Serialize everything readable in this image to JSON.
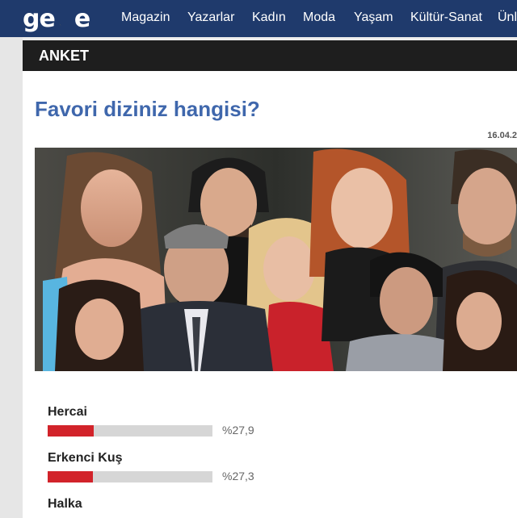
{
  "site": {
    "logo_text": "gece",
    "nav": [
      "Magazin",
      "Yazarlar",
      "Kadın",
      "Moda",
      "Yaşam",
      "Kültür-Sanat",
      "Ünl"
    ]
  },
  "section": {
    "title": "ANKET"
  },
  "article": {
    "title": "Favori diziniz hangisi?",
    "date": "16.04.2"
  },
  "poll": {
    "options": [
      {
        "label": "Hercai",
        "percent_text": "%27,9",
        "percent": 27.9
      },
      {
        "label": "Erkenci Kuş",
        "percent_text": "%27,3",
        "percent": 27.3
      },
      {
        "label": "Halka",
        "percent_text": "",
        "percent": null
      }
    ]
  },
  "colors": {
    "nav_bg": "#1f3a6c",
    "section_bar": "#1e1e1e",
    "headline": "#3f67ac",
    "bar_fill": "#d2232a",
    "bar_track": "#d6d6d6",
    "logo_moon": "#f0b429"
  }
}
